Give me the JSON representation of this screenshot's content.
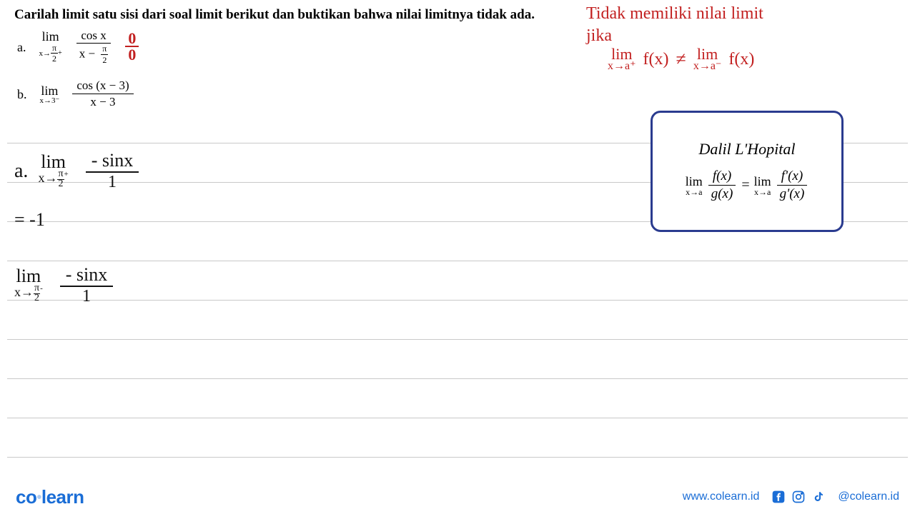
{
  "question": "Carilah limit satu sisi dari soal limit berikut dan buktikan bahwa nilai limitnya tidak ada.",
  "problems": {
    "a": {
      "label": "a.",
      "lim": "lim",
      "sub": "x→π⁺⁄₂",
      "num": "cos x",
      "den_left": "x −",
      "den_pi": "π",
      "den_2": "2"
    },
    "b": {
      "label": "b.",
      "lim": "lim",
      "sub": "x→3⁻",
      "num": "cos (x − 3)",
      "den": "x − 3"
    }
  },
  "red_frac": {
    "num": "0",
    "den": "0"
  },
  "red_notes": {
    "line1": "Tidak memiliki nilai limit",
    "line2": "jika",
    "lim_plus_top": "lim",
    "lim_plus_bot": "x→a⁺",
    "fx1": "f(x)",
    "neq": "≠",
    "lim_minus_top": "lim",
    "lim_minus_bot": "x→a⁻",
    "fx2": "f(x)"
  },
  "lhopital": {
    "title": "Dalil L'Hopital",
    "lim": "lim",
    "sub": "x→a",
    "f": "f(x)",
    "g": "g(x)",
    "eq": "=",
    "fp": "f'(x)",
    "gp": "g'(x)"
  },
  "work": {
    "a_label": "a.",
    "lim1_top": "lim",
    "lim1_bot_x": "x→",
    "pi": "π",
    "two": "2",
    "plus": "+",
    "minus_sinx": "- sinx",
    "over1": "1",
    "eq_neg1": "= -1",
    "lim2_top": "lim",
    "minus": "-",
    "minus_sinx2": "- sinx",
    "over1_2": "1"
  },
  "footer": {
    "logo_co": "co",
    "logo_learn": "learn",
    "url": "www.colearn.id",
    "handle": "@colearn.id"
  }
}
